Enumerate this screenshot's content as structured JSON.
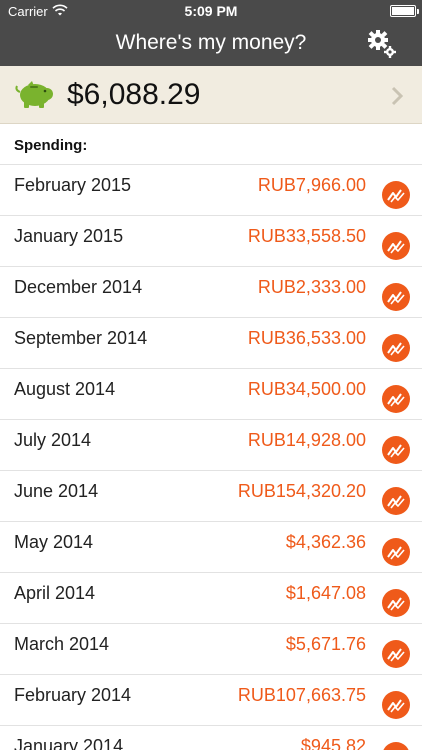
{
  "status_bar": {
    "carrier": "Carrier",
    "time": "5:09 PM"
  },
  "nav": {
    "title": "Where's my money?",
    "settings_icon": "gear-icon"
  },
  "balance": {
    "amount": "$6,088.29",
    "icon": "piggy-bank-icon"
  },
  "spending": {
    "heading": "Spending:",
    "items": [
      {
        "month": "February 2015",
        "amount": "RUB7,966.00"
      },
      {
        "month": "January 2015",
        "amount": "RUB33,558.50"
      },
      {
        "month": "December 2014",
        "amount": "RUB2,333.00"
      },
      {
        "month": "September 2014",
        "amount": "RUB36,533.00"
      },
      {
        "month": "August 2014",
        "amount": "RUB34,500.00"
      },
      {
        "month": "July 2014",
        "amount": "RUB14,928.00"
      },
      {
        "month": "June 2014",
        "amount": "RUB154,320.20"
      },
      {
        "month": "May 2014",
        "amount": "$4,362.36"
      },
      {
        "month": "April 2014",
        "amount": "$1,647.08"
      },
      {
        "month": "March 2014",
        "amount": "$5,671.76"
      },
      {
        "month": "February 2014",
        "amount": "RUB107,663.75"
      },
      {
        "month": "January 2014",
        "amount": "$945.82"
      }
    ]
  },
  "colors": {
    "accent": "#ef5a1a",
    "navbar": "#4a4a4a",
    "balance_bg": "#f1ece0",
    "piggy": "#7ab32e"
  }
}
